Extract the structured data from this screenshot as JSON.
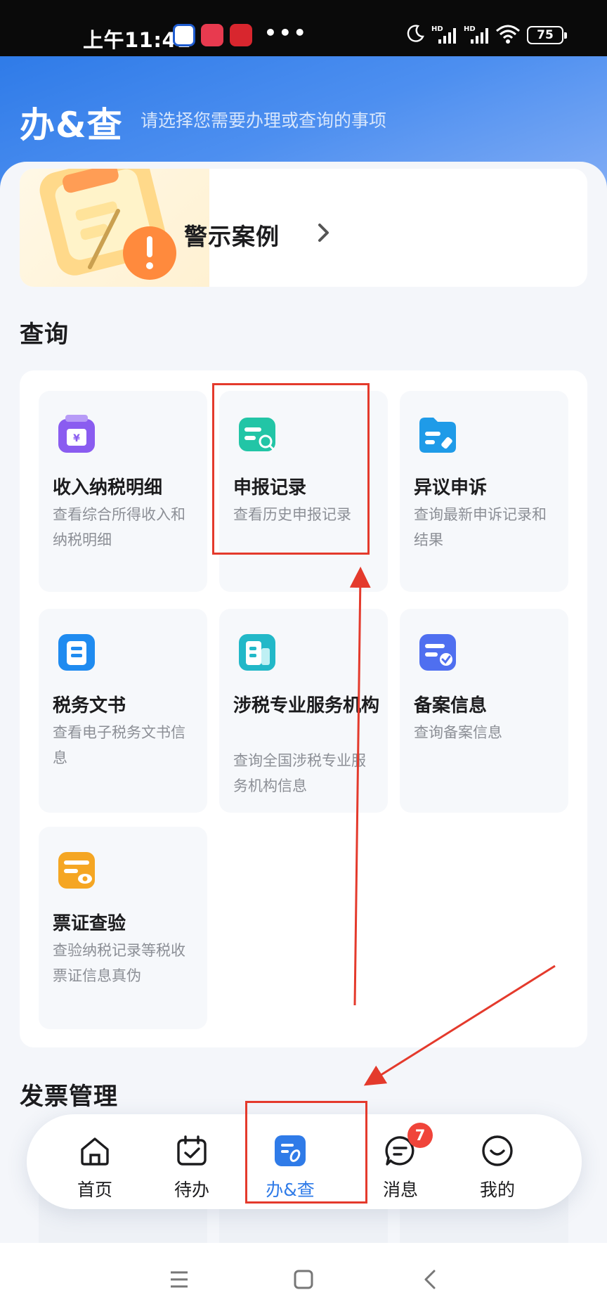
{
  "status_bar": {
    "time": "上午11:41",
    "dots": "•••",
    "battery": "75",
    "icons": [
      "baidu-app-icon",
      "red-app-icon",
      "news-app-icon",
      "moon-icon",
      "hd-signal-icon",
      "hd-signal-icon",
      "wifi-icon",
      "battery-icon"
    ]
  },
  "header": {
    "title": "办&查",
    "subtitle": "请选择您需要办理或查询的事项"
  },
  "banner": {
    "title": "警示案例",
    "arrow": "chevron-right-icon"
  },
  "query_section": {
    "title": "查询",
    "tiles": [
      {
        "title": "收入纳税明细",
        "desc": "查看综合所得收入和纳税明细",
        "icon": "income-wallet-icon",
        "color": "#8a5cf0"
      },
      {
        "title": "申报记录",
        "desc": "查看历史申报记录",
        "icon": "declaration-search-icon",
        "color": "#22c5a6"
      },
      {
        "title": "异议申诉",
        "desc": "查询最新申诉记录和结果",
        "icon": "appeal-folder-icon",
        "color": "#1f9be8"
      },
      {
        "title": "税务文书",
        "desc": "查看电子税务文书信息",
        "icon": "tax-document-icon",
        "color": "#1f8bf0"
      },
      {
        "title": "涉税专业服务机构",
        "desc": "查询全国涉税专业服务机构信息",
        "icon": "service-agency-icon",
        "color": "#22b8c8"
      },
      {
        "title": "备案信息",
        "desc": "查询备案信息",
        "icon": "filing-info-icon",
        "color": "#4f6ff0"
      },
      {
        "title": "票证查验",
        "desc": "查验纳税记录等税收票证信息真伪",
        "icon": "ticket-verify-icon",
        "color": "#f5a623"
      }
    ]
  },
  "invoice_section": {
    "title": "发票管理"
  },
  "bottom_nav": {
    "items": [
      {
        "label": "首页",
        "icon": "home-icon"
      },
      {
        "label": "待办",
        "icon": "calendar-todo-icon"
      },
      {
        "label": "办&查",
        "icon": "handle-query-icon",
        "active": true
      },
      {
        "label": "消息",
        "icon": "message-icon",
        "badge": "7"
      },
      {
        "label": "我的",
        "icon": "profile-smile-icon"
      }
    ]
  },
  "system_nav": {
    "icons": [
      "menu-icon",
      "home-square-icon",
      "back-icon"
    ]
  },
  "colors": {
    "brand_blue": "#2f7be8",
    "annotation_red": "#e43a2c",
    "badge_red": "#f0443a"
  }
}
